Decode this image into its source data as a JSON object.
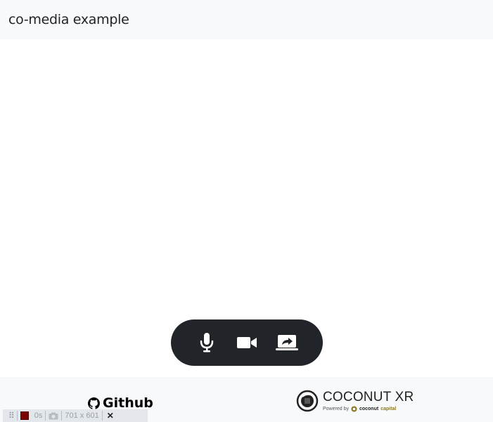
{
  "header": {
    "title": "co-media example"
  },
  "controls": {
    "microphone_icon": "microphone-icon",
    "camera_icon": "video-camera-icon",
    "share_icon": "screen-share-icon",
    "background_color": "#212529"
  },
  "footer": {
    "github_label": "Github",
    "brand_name": "COCONUT XR",
    "powered_by": "Powered by",
    "powered_brand": "coconut",
    "powered_brand_suffix": "capital"
  },
  "devbar": {
    "timer": "0s",
    "dimensions": "701 x 601"
  }
}
